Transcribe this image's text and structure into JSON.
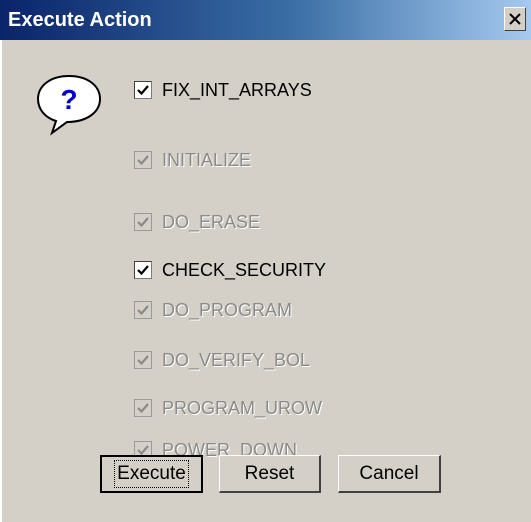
{
  "window": {
    "title": "Execute Action",
    "close_glyph": "X"
  },
  "dialog": {
    "icon": "question-icon",
    "checkboxes": [
      {
        "label": "FIX_INT_ARRAYS",
        "checked": true,
        "enabled": true
      },
      {
        "label": "INITIALIZE",
        "checked": true,
        "enabled": false
      },
      {
        "label": "DO_ERASE",
        "checked": true,
        "enabled": false
      },
      {
        "label": "CHECK_SECURITY",
        "checked": true,
        "enabled": true
      },
      {
        "label": "DO_PROGRAM",
        "checked": true,
        "enabled": false
      },
      {
        "label": "DO_VERIFY_BOL",
        "checked": true,
        "enabled": false
      },
      {
        "label": "PROGRAM_UROW",
        "checked": true,
        "enabled": false
      },
      {
        "label": "POWER_DOWN",
        "checked": true,
        "enabled": false
      }
    ]
  },
  "buttons": {
    "execute": "Execute",
    "reset": "Reset",
    "cancel": "Cancel"
  },
  "colors": {
    "face": "#d4d0c8",
    "title_start": "#0a246a",
    "title_end": "#a6caf0",
    "disabled_text": "#8a8a8a",
    "icon_blue": "#0000cc"
  }
}
